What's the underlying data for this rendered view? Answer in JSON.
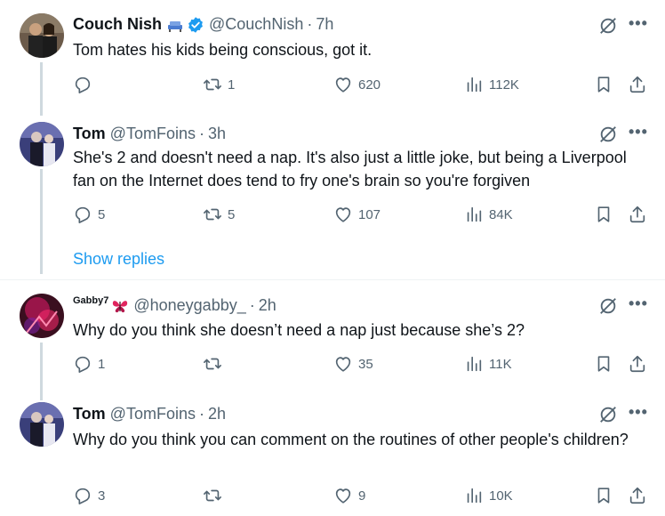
{
  "tweets": [
    {
      "name": "Couch Nish",
      "handle": "@CouchNish",
      "time": "7h",
      "text": "Tom hates his kids being conscious, got it.",
      "replies": "",
      "reposts": "1",
      "likes": "620",
      "views": "112K"
    },
    {
      "name": "Tom",
      "handle": "@TomFoins",
      "time": "3h",
      "text": "She's 2 and doesn't need a nap. It's also just a little joke, but being a Liverpool fan on the Internet does tend to fry one's brain so you're forgiven",
      "replies": "5",
      "reposts": "5",
      "likes": "107",
      "views": "84K"
    },
    {
      "name": "Gabby7",
      "handle": "@honeygabby_",
      "time": "2h",
      "text": "Why do you think she doesn’t need a nap just because she’s 2?",
      "replies": "1",
      "reposts": "",
      "likes": "35",
      "views": "11K"
    },
    {
      "name": "Tom",
      "handle": "@TomFoins",
      "time": "2h",
      "text": "Why do you think you can comment on the routines of other people's children?",
      "replies": "3",
      "reposts": "",
      "likes": "9",
      "views": "10K"
    }
  ],
  "show_replies_label": "Show replies",
  "separator": "·",
  "more_label": "•••",
  "icons": {
    "reply": "reply-icon",
    "repost": "repost-icon",
    "like": "like-icon",
    "views": "views-icon",
    "bookmark": "bookmark-icon",
    "share": "share-icon",
    "grok": "grok-icon",
    "verified": "verified-badge-icon",
    "butterfly": "butterfly-icon",
    "couch": "couch-icon"
  },
  "colors": {
    "accent": "#1d9bf0",
    "muted": "#536471",
    "text": "#0f1419",
    "verified": "#1d9bf0",
    "butterfly": "#e0245e"
  }
}
